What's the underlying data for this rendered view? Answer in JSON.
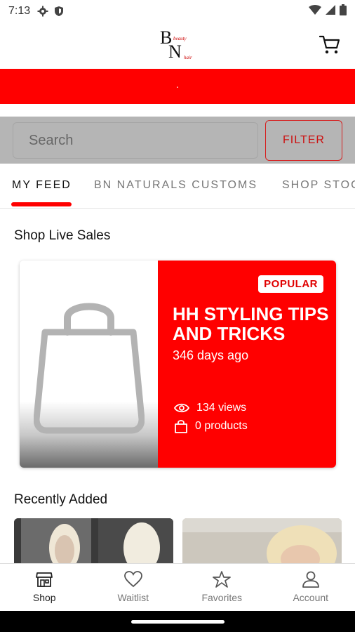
{
  "status_bar": {
    "time": "7:13",
    "icons": [
      "gear-icon",
      "shield-icon",
      "wifi-icon",
      "signal-icon",
      "battery-icon"
    ]
  },
  "header": {
    "logo": {
      "letter_b": "B",
      "letter_n": "N",
      "script_top": "beauty",
      "script_bottom": "hair"
    },
    "cart_icon": "cart-icon"
  },
  "promo_banner": {
    "text": "·",
    "color": "#ff0000"
  },
  "search": {
    "placeholder": "Search",
    "filter_label": "FILTER"
  },
  "tabs": [
    {
      "label": "MY FEED",
      "active": true
    },
    {
      "label": "BN NATURALS CUSTOMS",
      "active": false
    },
    {
      "label": "SHOP STOCK",
      "active": false
    }
  ],
  "live_sales": {
    "section_title": "Shop Live Sales",
    "card": {
      "badge": "POPULAR",
      "title": "HH STYLING TIPS AND TRICKS",
      "time_ago": "346 days ago",
      "views": "134 views",
      "products": "0 products"
    }
  },
  "recently_added": {
    "section_title": "Recently Added"
  },
  "bottom_nav": [
    {
      "label": "Shop",
      "icon": "storefront-icon",
      "active": true
    },
    {
      "label": "Waitlist",
      "icon": "heart-icon",
      "active": false
    },
    {
      "label": "Favorites",
      "icon": "star-icon",
      "active": false
    },
    {
      "label": "Account",
      "icon": "person-icon",
      "active": false
    }
  ],
  "colors": {
    "accent": "#ff0000",
    "search_bg": "#b5b5b5"
  }
}
